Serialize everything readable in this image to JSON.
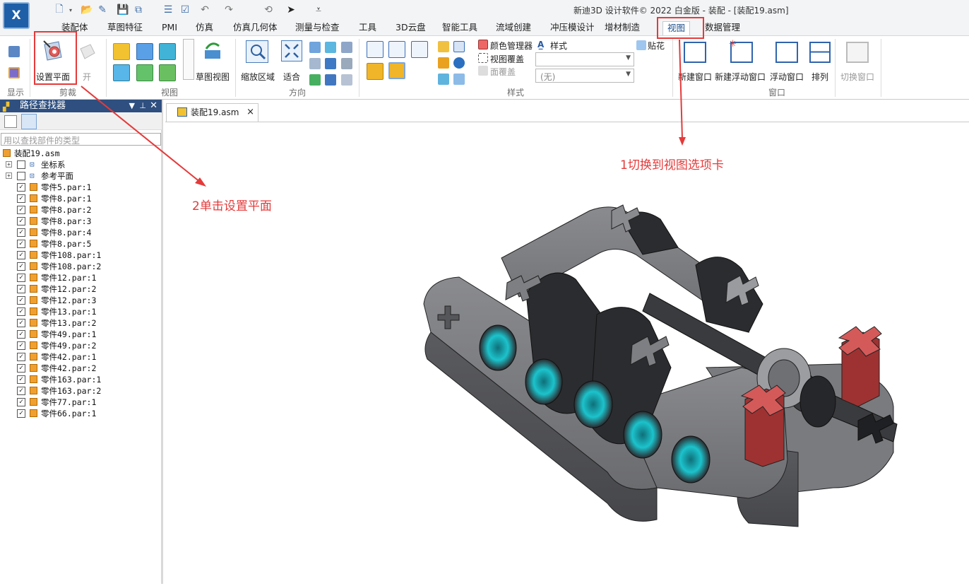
{
  "window": {
    "title": "新迪3D 设计软件© 2022 白金版 - 装配 - [装配19.asm]",
    "logo_text": "X"
  },
  "quick_access": [
    "new-icon",
    "dropdown-icon",
    "open-icon",
    "pin-icon",
    "save-icon",
    "save-all-icon",
    "list-icon",
    "checklist-icon",
    "undo-icon",
    "redo-icon",
    "history-icon",
    "select-icon",
    "customize-icon"
  ],
  "tabs": [
    "装配体",
    "草图特征",
    "PMI",
    "仿真",
    "仿真几何体",
    "测量与检查",
    "工具",
    "3D云盘",
    "智能工具",
    "流域创建",
    "冲压模设计",
    "增材制造",
    "视图",
    "数据管理"
  ],
  "active_tab": "视图",
  "ribbon": {
    "groups": [
      "显示",
      "剪裁",
      "视图",
      "方向",
      "样式",
      "窗口"
    ],
    "clip": {
      "set_plane": "设置平面",
      "open": "开"
    },
    "view": {
      "sketch_view": "草图视图"
    },
    "orient": {
      "zoom_area": "缩放区域",
      "fit": "适合"
    },
    "style": {
      "color_manager": "颜色管理器",
      "view_override": "视图覆盖",
      "face_override": "面覆盖",
      "style": "样式",
      "decal": "贴花",
      "combo_none": "(无)"
    },
    "window": {
      "new_window": "新建窗口",
      "new_float": "新建浮动窗口",
      "float": "浮动窗口",
      "arrange": "排列",
      "switch": "切换窗口"
    }
  },
  "panel": {
    "title": "路径查找器",
    "search_placeholder": "用以查找部件的类型",
    "root": "装配19.asm",
    "nodes": [
      "坐标系",
      "参考平面"
    ],
    "parts": [
      "零件5.par:1",
      "零件8.par:1",
      "零件8.par:2",
      "零件8.par:3",
      "零件8.par:4",
      "零件8.par:5",
      "零件108.par:1",
      "零件108.par:2",
      "零件12.par:1",
      "零件12.par:2",
      "零件12.par:3",
      "零件13.par:1",
      "零件13.par:2",
      "零件49.par:1",
      "零件49.par:2",
      "零件42.par:1",
      "零件42.par:2",
      "零件163.par:1",
      "零件163.par:2",
      "零件77.par:1",
      "零件66.par:1"
    ]
  },
  "document": {
    "tab": "装配19.asm",
    "close": "×"
  },
  "annotations": {
    "step1": "1切换到视图选项卡",
    "step2": "2单击设置平面"
  },
  "colors": {
    "accent": "#e53a3a",
    "panel_header": "#2e4f7f",
    "part_gray": "#6e6f73",
    "part_cyan": "#19c2c9",
    "part_red": "#b23a3a"
  }
}
